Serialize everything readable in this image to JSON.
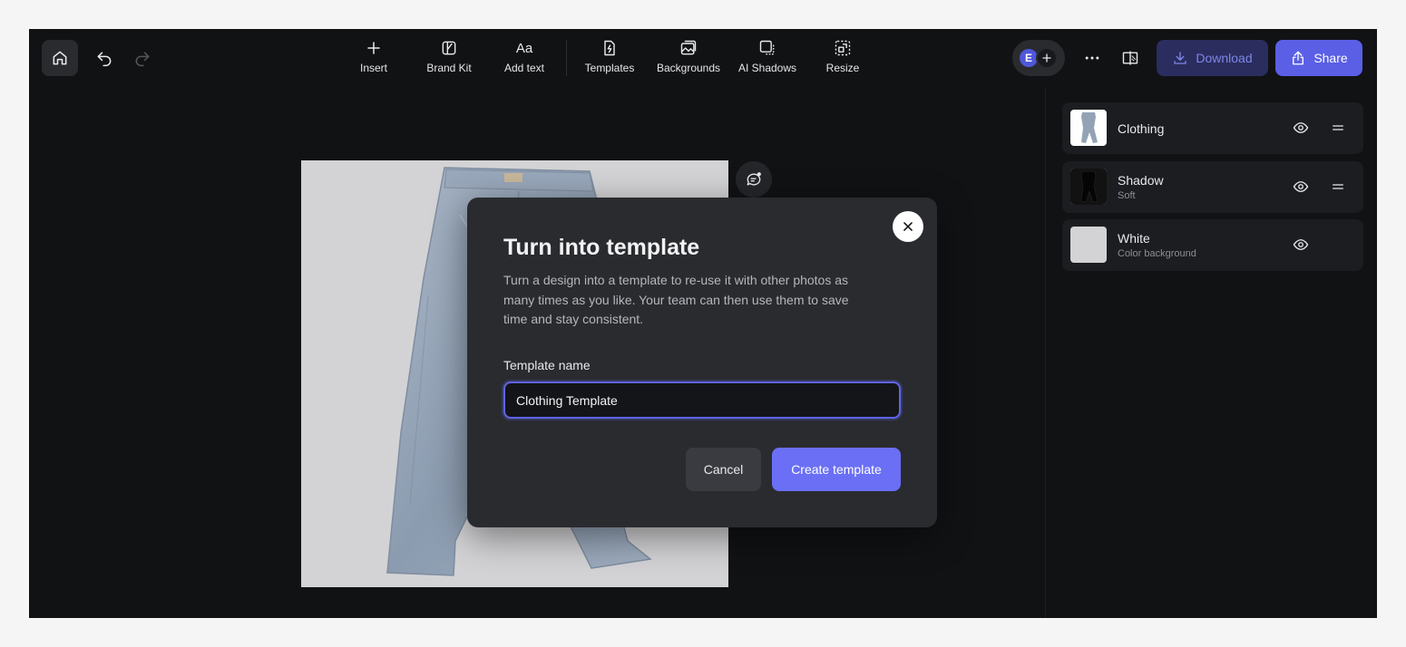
{
  "toolbar": {
    "tools": {
      "insert": "Insert",
      "brand_kit": "Brand Kit",
      "add_text": "Add text",
      "add_text_glyph": "Aa",
      "templates": "Templates",
      "backgrounds": "Backgrounds",
      "ai_shadows": "AI Shadows",
      "resize": "Resize"
    },
    "avatar_initial": "E",
    "download_label": "Download",
    "share_label": "Share"
  },
  "layers": [
    {
      "name": "Clothing",
      "sub": ""
    },
    {
      "name": "Shadow",
      "sub": "Soft"
    },
    {
      "name": "White",
      "sub": "Color background"
    }
  ],
  "modal": {
    "title": "Turn into template",
    "description": "Turn a design into a template to re-use it with other photos as many times as you like. Your team can then use them to save time and stay consistent.",
    "field_label": "Template name",
    "field_value": "Clothing Template",
    "cancel_label": "Cancel",
    "create_label": "Create template"
  },
  "colors": {
    "app_bg": "#111214",
    "modal_bg": "#2a2b2f",
    "accent": "#6a6ff5",
    "share": "#5a5fe6",
    "download_bg": "#2a2d5e",
    "photo_bg": "#d3d3d5"
  },
  "icons": {
    "home": "home-icon",
    "undo": "undo-icon",
    "redo": "redo-icon",
    "insert": "plus-icon",
    "brand_kit": "brand-kit-icon",
    "templates": "template-bolt-icon",
    "backgrounds": "backgrounds-icon",
    "ai_shadows": "shadow-icon",
    "resize": "resize-icon",
    "more": "more-horizontal-icon",
    "compare": "compare-icon",
    "download": "download-icon",
    "share": "share-icon",
    "comment": "comment-add-icon",
    "eye": "eye-icon",
    "drag": "drag-handle-icon",
    "close": "close-icon"
  }
}
